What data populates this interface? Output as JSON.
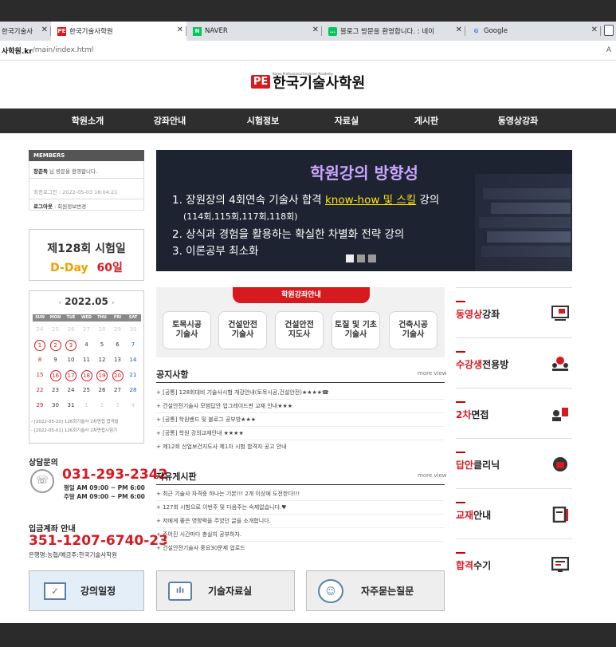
{
  "browser": {
    "tabs": [
      {
        "label": "한국기술사",
        "favicon": "generic-page-icon",
        "active": false
      },
      {
        "label": "한국기술사학원",
        "favicon": "PE",
        "active": true
      },
      {
        "label": "NAVER",
        "favicon": "N",
        "active": false
      },
      {
        "label": "블로그 방문을 환영합니다. : 네이",
        "favicon": "chat-icon",
        "active": false
      },
      {
        "label": "Google",
        "favicon": "G",
        "active": false
      }
    ],
    "url_host": "사학원.kr",
    "url_path": "/main/index.html",
    "reader_label": "A"
  },
  "site": {
    "logo_badge": "PE",
    "logo_text": "한국기술사학원",
    "logo_sub": "Korea Professional Engineer Academy"
  },
  "nav": [
    "학원소개",
    "강좌안내",
    "시험정보",
    "자료실",
    "게시판",
    "동영상강좌"
  ],
  "members": {
    "head": "MEMBERS",
    "welcome_name": "장준득",
    "welcome_suffix": "님 방문을 환영합니다.",
    "last_login": "최종로그인 : 2022-05-03 18:04:21",
    "logout": "로그아웃",
    "edit": "회원정보변경"
  },
  "dday": {
    "exam": "제128회 시험일",
    "label": "D-Day",
    "days": "60일"
  },
  "calendar": {
    "prev": "‹",
    "title": "2022.05",
    "next": "›",
    "weekdays": [
      "SUN",
      "MON",
      "TUE",
      "WED",
      "THU",
      "FRI",
      "SAT"
    ],
    "notes": [
      "- [2022-05-20] 126회기술사 2차면접 합격발",
      "- [2022-05-01] 126회기술사 2차면접시험기"
    ]
  },
  "consult": {
    "title": "상담문의",
    "phone": "031-293-2342",
    "weekday": "평일 AM 09:00 ~ PM 6:00",
    "weekend": "주말 AM 09:00 ~ PM 6:00"
  },
  "account": {
    "title": "입금계좌 안내",
    "number": "351-1207-6740-23",
    "bank": "은행명:농협/예금주:한국기술사학원"
  },
  "banner": {
    "title": "학원강의 방향성",
    "l1_pre": "1. 장원장의 4회연속 기술사 합격 ",
    "l1_u": "know-how 및 스킬",
    "l1_post": " 강의",
    "l1_sub": "(114회,115회,117회,118회)",
    "l2": "2. 상식과 경험을 활용하는 확실한 차별화 전략 강의",
    "l3": "3. 이론공부 최소화"
  },
  "courses": {
    "tab": "학원강좌안내",
    "items": [
      {
        "l1": "토목시공",
        "l2": "기술사"
      },
      {
        "l1": "건설안전",
        "l2": "기술사"
      },
      {
        "l1": "건설안전",
        "l2": "지도사"
      },
      {
        "l1": "토질 및 기초",
        "l2": "기술사"
      },
      {
        "l1": "건축시공",
        "l2": "기술사"
      }
    ]
  },
  "notices": {
    "title": "공지사항",
    "more": "more view",
    "items": [
      "+ [공통] 128회대비 기술사시험 개강안내(토목시공,건설안전)★★★★☎",
      "+ 건설안전기술사 모범답안 업그레이드판 교재 안내★★★",
      "+ [공통] 학원밴드 및 블로그 공부방★★★",
      "+ [공통] 학원 강의교재안내 ★★★★",
      "+ 제12회 산업보건지도사 제1차 시험 합격자 공고 안내"
    ]
  },
  "board": {
    "title": "자유게시판",
    "more": "more view",
    "items": [
      "+ 최근 기술사 자격증 하나는 기본!!! 2개 이상에 도전한다!!!",
      "+ 127회 시험으로 이번주 및 다음주는 숙제없습니다.♥",
      "+ 저에게 좋은 영향력을 주었던 글을 소개합니다.",
      "+ 주어진 시간마다 충실히 공부하자.",
      "+ 건설안전기술사 중요30문제 업로드"
    ]
  },
  "side": [
    {
      "red": "동영상",
      "black": "강좌",
      "icon": "video-lecture-icon"
    },
    {
      "red": "수강생",
      "black": "전용방",
      "icon": "student-room-icon"
    },
    {
      "red": "2차",
      "black": "면접",
      "icon": "interview-icon"
    },
    {
      "red": "답안",
      "black": "클리닉",
      "icon": "answer-clinic-icon"
    },
    {
      "red": "교재",
      "black": "안내",
      "icon": "textbook-icon"
    },
    {
      "red": "합격",
      "black": "수기",
      "icon": "success-story-icon"
    }
  ],
  "bottom": {
    "schedule": "강의일정",
    "materials": "기술자료실",
    "faq": "자주묻는질문"
  }
}
